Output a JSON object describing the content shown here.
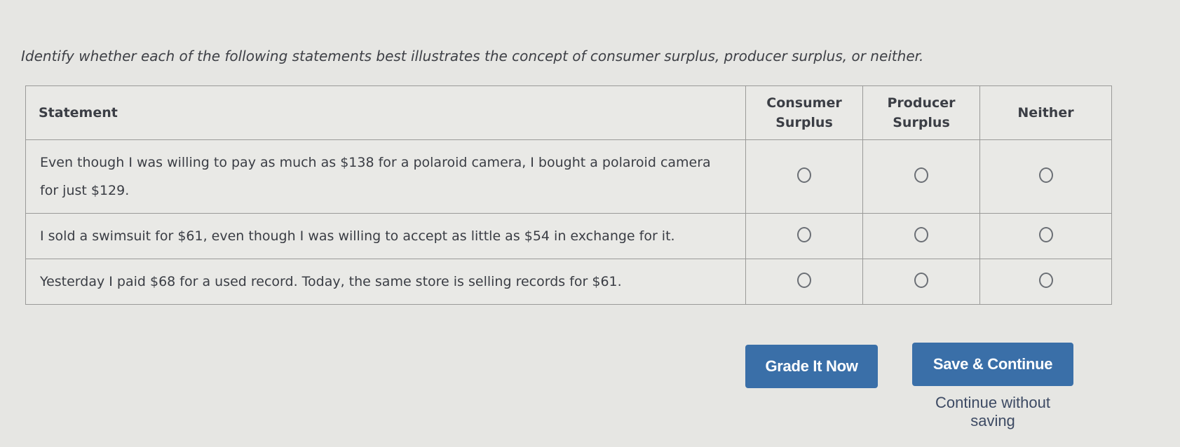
{
  "prompt": "Identify whether each of the following statements best illustrates the concept of consumer surplus, producer surplus, or neither.",
  "table": {
    "headers": {
      "statement": "Statement",
      "consumer": "Consumer Surplus",
      "producer": "Producer Surplus",
      "neither": "Neither"
    },
    "rows": [
      {
        "statement": "Even though I was willing to pay as much as $138 for a polaroid camera, I bought a polaroid camera for just $129.",
        "selected": null
      },
      {
        "statement": "I sold a swimsuit for $61, even though I was willing to accept as little as $54 in exchange for it.",
        "selected": null
      },
      {
        "statement": "Yesterday I paid $68 for a used record. Today, the same store is selling records for $61.",
        "selected": null
      }
    ]
  },
  "buttons": {
    "grade": "Grade It Now",
    "save": "Save & Continue",
    "continue_link": "Continue without saving"
  },
  "colors": {
    "button_bg": "#3a6fa8",
    "background": "#e6e6e3"
  }
}
